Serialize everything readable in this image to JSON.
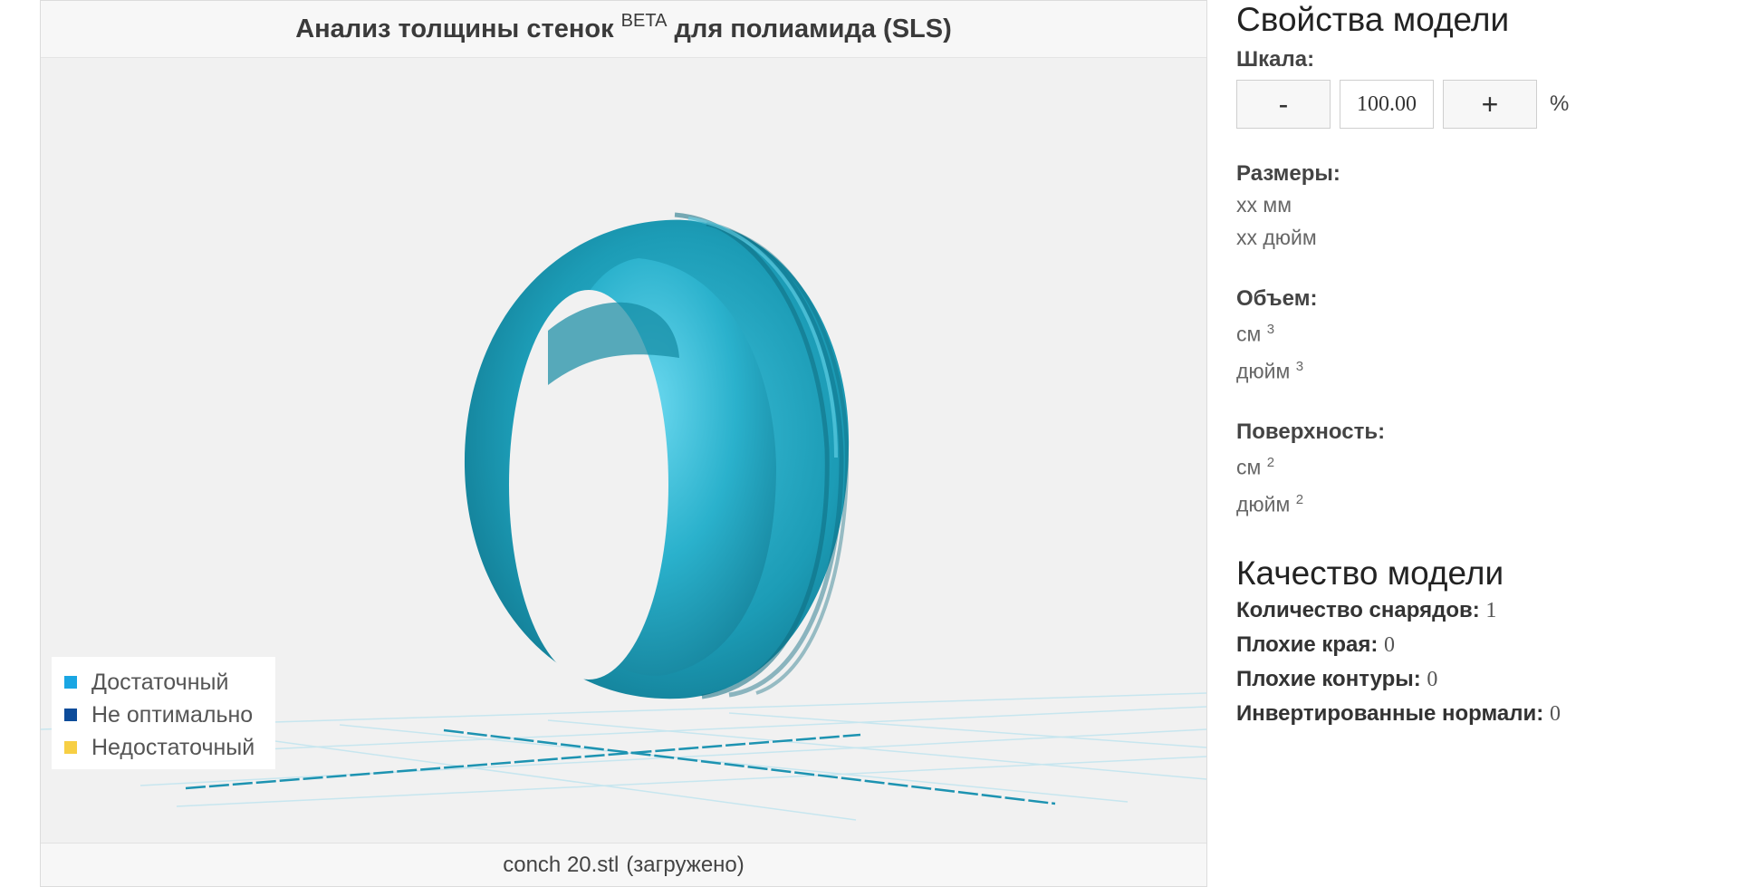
{
  "viewer": {
    "title": "Анализ толщины стенок",
    "title_sup": "BETA",
    "title_suffix": "для полиамида (SLS)",
    "model_color": "#1c9cb6",
    "grid_color": "#9fd3e3",
    "legend": [
      {
        "label": "Достаточный",
        "color": "#1aa6e3"
      },
      {
        "label": "Не оптимально",
        "color": "#0d4c9a"
      },
      {
        "label": "Недостаточный",
        "color": "#f7cf44"
      }
    ],
    "file_name": "conch 20.stl",
    "file_status": "(загружено)"
  },
  "properties": {
    "heading": "Свойства модели",
    "scale_label": "Шкала:",
    "minus_label": "-",
    "scale_value": "100.00",
    "plus_label": "+",
    "percent": "%",
    "dimensions_label": "Размеры:",
    "dimensions_mm": "xx мм",
    "dimensions_in": "xx дюйм",
    "volume_label": "Объем:",
    "volume_cm": "см",
    "volume_in": "дюйм",
    "volume_exp": "3",
    "surface_label": "Поверхность:",
    "surface_cm": "см",
    "surface_in": "дюйм",
    "surface_exp": "2"
  },
  "quality": {
    "heading": "Качество модели",
    "items": [
      {
        "label": "Количество снарядов:",
        "value": "1"
      },
      {
        "label": "Плохие края:",
        "value": "0"
      },
      {
        "label": "Плохие контуры:",
        "value": "0"
      },
      {
        "label": "Инвертированные нормали:",
        "value": "0"
      }
    ]
  }
}
